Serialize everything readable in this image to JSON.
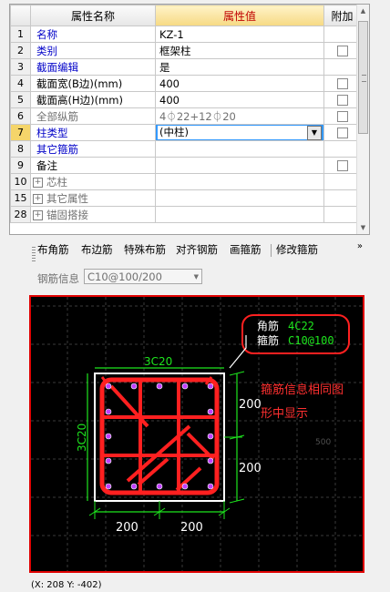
{
  "grid": {
    "headers": {
      "name": "属性名称",
      "value": "属性值",
      "extra": "附加"
    },
    "rows": [
      {
        "num": "1",
        "name": "名称",
        "value": "KZ-1",
        "style": "blue",
        "checkbox": false
      },
      {
        "num": "2",
        "name": "类别",
        "value": "框架柱",
        "style": "blue",
        "checkbox": true
      },
      {
        "num": "3",
        "name": "截面编辑",
        "value": "是",
        "style": "blue",
        "checkbox": false
      },
      {
        "num": "4",
        "name": "截面宽(B边)(mm)",
        "value": "400",
        "style": "normal",
        "checkbox": true
      },
      {
        "num": "5",
        "name": "截面高(H边)(mm)",
        "value": "400",
        "style": "normal",
        "checkbox": true
      },
      {
        "num": "6",
        "name": "全部纵筋",
        "value": "4⏀22+12⏀20",
        "style": "gray",
        "checkbox": true
      },
      {
        "num": "7",
        "name": "柱类型",
        "value": "(中柱)",
        "style": "blue",
        "checkbox": true,
        "selected": true
      },
      {
        "num": "8",
        "name": "其它箍筋",
        "value": "",
        "style": "blue",
        "checkbox": false
      },
      {
        "num": "9",
        "name": "备注",
        "value": "",
        "style": "normal",
        "checkbox": true
      },
      {
        "num": "10",
        "name": "芯柱",
        "value": "",
        "style": "group",
        "checkbox": false
      },
      {
        "num": "15",
        "name": "其它属性",
        "value": "",
        "style": "group",
        "checkbox": false
      },
      {
        "num": "28",
        "name": "锚固搭接",
        "value": "",
        "style": "group",
        "checkbox": false
      }
    ],
    "expand_symbol": "+"
  },
  "toolbar": {
    "items": [
      "布角筋",
      "布边筋",
      "特殊布筋",
      "对齐钢筋",
      "画箍筋",
      "修改箍筋"
    ],
    "more": "»"
  },
  "rebar_info": {
    "label": "钢筋信息",
    "value": "C10@100/200"
  },
  "drawing": {
    "callout_labels": [
      "角筋",
      "箍筋"
    ],
    "callout_values": [
      "4C22",
      "C10@100"
    ],
    "top_label": "3C20",
    "left_label": "3C20",
    "right_dims": [
      "200",
      "200"
    ],
    "bottom_dims": [
      "200",
      "200"
    ],
    "note_lines": [
      "箍筋信息相同图",
      "形中显示"
    ],
    "faint_label": "500",
    "colors": {
      "canvas": "#000000",
      "bars": "#ff2020",
      "green": "#1ee61e",
      "border": "#e00000",
      "note": "#ff3030",
      "outline": "#ffffff"
    }
  },
  "status": {
    "coords": "(X: 208 Y: -402)"
  }
}
